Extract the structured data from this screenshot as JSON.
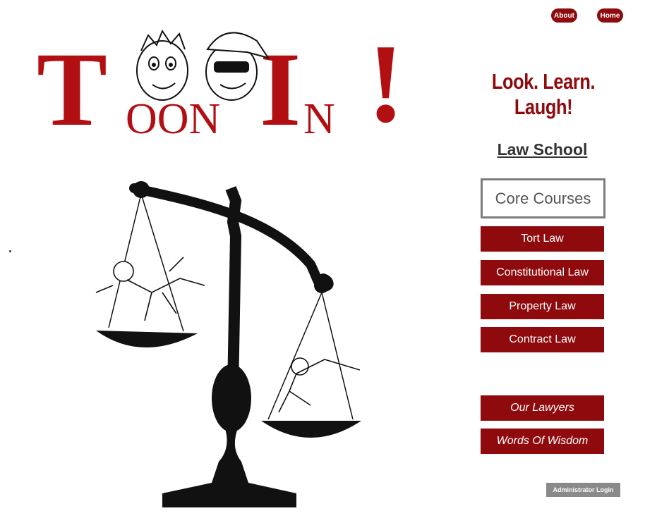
{
  "nav": {
    "about_label": "About",
    "home_label": "Home"
  },
  "logo": {
    "text": "Toon In!"
  },
  "tagline": "Look. Learn. Laugh!",
  "section_title": "Law School",
  "core_courses_label": "Core Courses",
  "courses": [
    "Tort Law",
    "Constitutional Law",
    "Property Law",
    "Contract Law"
  ],
  "extras": [
    "Our Lawyers",
    "Words Of Wisdom"
  ],
  "admin_label": "Administrator Login",
  "colors": {
    "brand_red": "#8e0a0d",
    "logo_red": "#b20f13",
    "admin_gray": "#8a8a8a"
  }
}
